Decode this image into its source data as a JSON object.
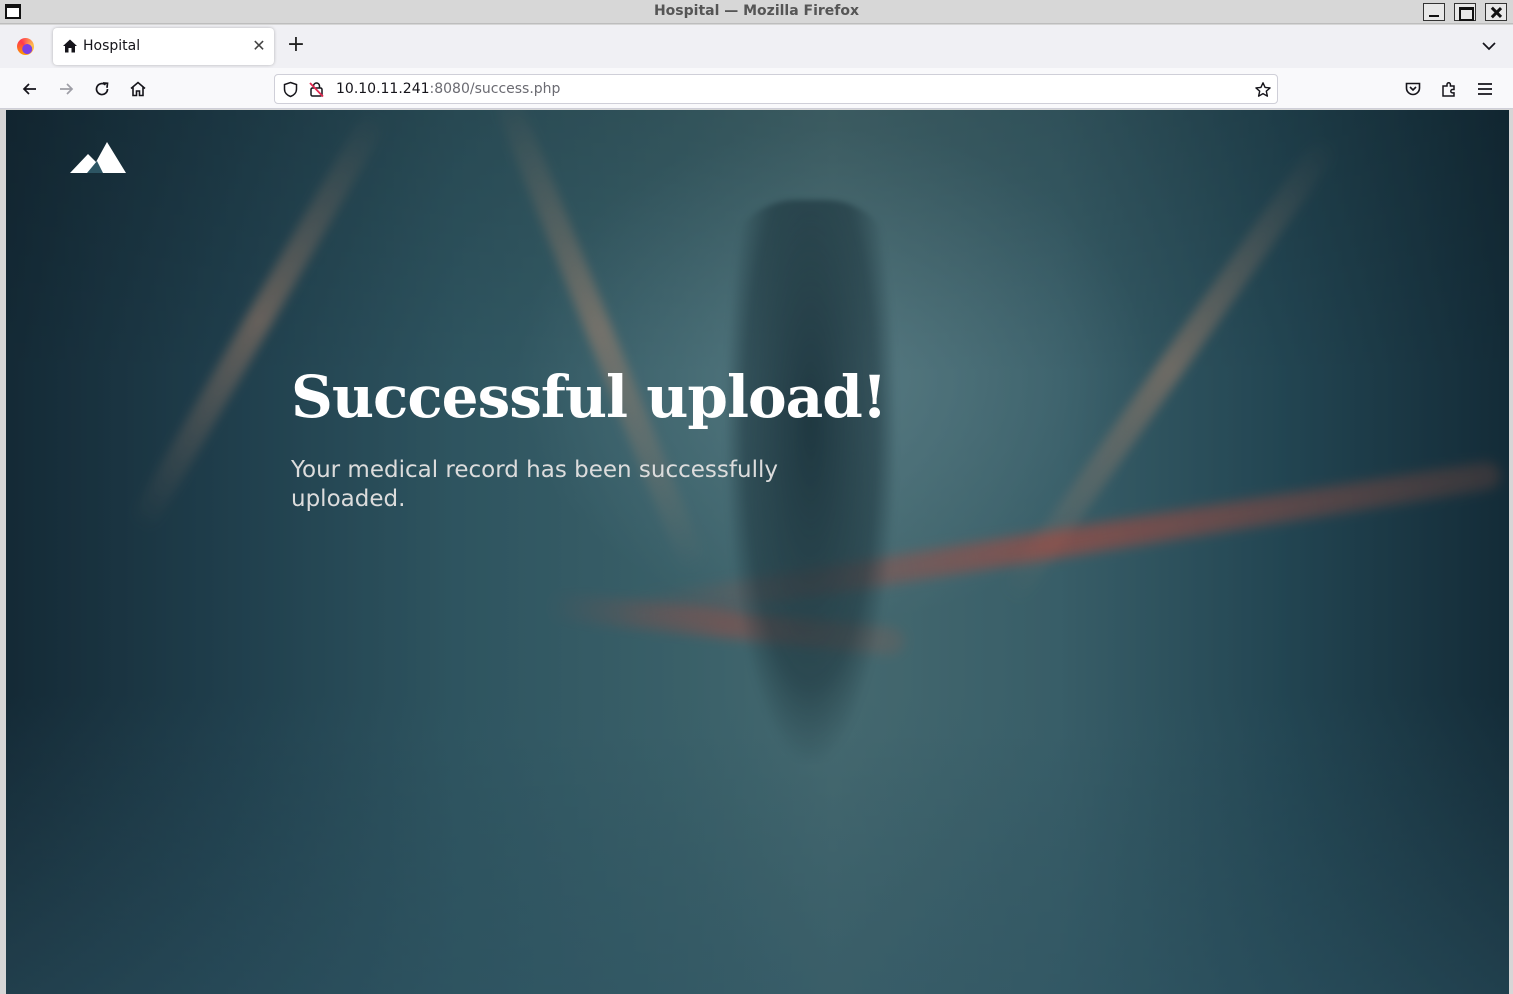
{
  "window": {
    "title": "Hospital — Mozilla Firefox"
  },
  "tabs": [
    {
      "label": "Hospital",
      "icon": "home-icon",
      "active": true
    }
  ],
  "navbar": {
    "url_host": "10.10.11.241",
    "url_rest": ":8080/success.php"
  },
  "page": {
    "heading": "Successful upload!",
    "message": "Your medical record has been successfully uploaded."
  },
  "colors": {
    "heading": "#ffffff",
    "message": "#dcdcdc"
  }
}
